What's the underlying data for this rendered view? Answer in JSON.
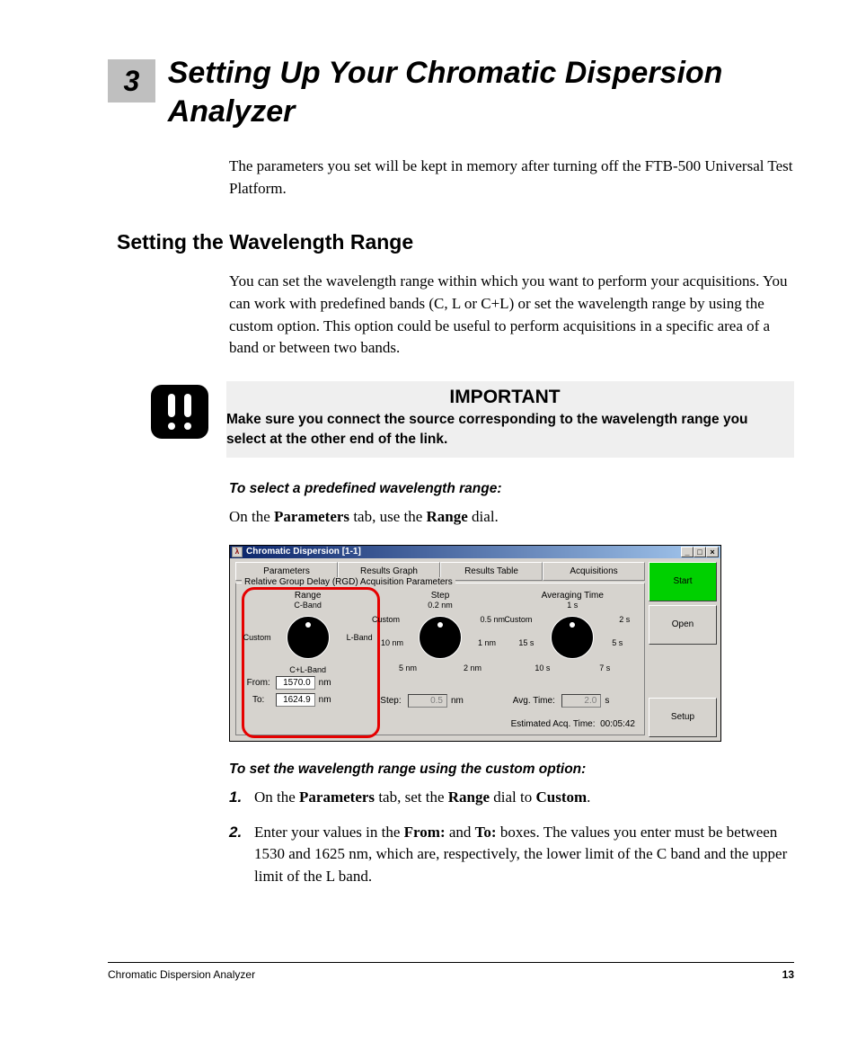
{
  "chapter": {
    "number": "3",
    "title": "Setting Up Your Chromatic Dispersion Analyzer"
  },
  "intro": "The parameters you set will be kept in memory after turning off the FTB-500 Universal Test Platform.",
  "section_heading": "Setting the Wavelength Range",
  "section_body": "You can set the wavelength range within which you want to perform your acquisitions. You can work with predefined bands (C, L or C+L) or set the wavelength range by using the custom option. This option could be useful to perform acquisitions in a specific area of a band or between two bands.",
  "important": {
    "heading": "IMPORTANT",
    "text": "Make sure you connect the source corresponding to the wavelength range you select at the other end of the link."
  },
  "procedure1": {
    "heading": "To select a predefined wavelength range:",
    "line_pre": "On the ",
    "line_b1": "Parameters",
    "line_mid": " tab, use the ",
    "line_b2": "Range",
    "line_post": " dial."
  },
  "procedure2": {
    "heading": "To set the wavelength range using the custom option:",
    "steps": [
      {
        "num": "1.",
        "pre": "On the ",
        "b1": "Parameters",
        "mid1": " tab, set the ",
        "b2": "Range",
        "mid2": " dial to ",
        "b3": "Custom",
        "post": "."
      },
      {
        "num": "2.",
        "pre": "Enter your values in the ",
        "b1": "From:",
        "mid1": " and ",
        "b2": "To:",
        "mid2": " boxes. The values you enter must be between 1530 and 1625 nm, which are, respectively, the lower limit of the C band and the upper limit of the L band.",
        "b3": "",
        "post": ""
      }
    ]
  },
  "screenshot": {
    "title": "Chromatic Dispersion [1-1]",
    "tabs": [
      "Parameters",
      "Results Graph",
      "Results Table",
      "Acquisitions"
    ],
    "groupbox_title": "Relative Group Delay (RGD) Acquisition Parameters",
    "range": {
      "title": "Range",
      "ticks": {
        "top": "C-Band",
        "left": "Custom",
        "right": "L-Band",
        "bottom": "C+L-Band"
      },
      "from_label": "From:",
      "from_value": "1570.0",
      "from_unit": "nm",
      "to_label": "To:",
      "to_value": "1624.9",
      "to_unit": "nm"
    },
    "step": {
      "title": "Step",
      "ticks": {
        "top": "0.2 nm",
        "tl": "Custom",
        "tr": "0.5 nm",
        "left": "10 nm",
        "right": "1 nm",
        "bl": "5 nm",
        "br": "2 nm"
      },
      "label": "Step:",
      "value": "0.5",
      "unit": "nm"
    },
    "avg": {
      "title": "Averaging Time",
      "ticks": {
        "top": "1 s",
        "tl": "Custom",
        "tr": "2 s",
        "left": "15 s",
        "right": "5 s",
        "bl": "10 s",
        "br": "7 s"
      },
      "label": "Avg. Time:",
      "value": "2.0",
      "unit": "s"
    },
    "est_label": "Estimated Acq. Time:",
    "est_value": "00:05:42",
    "buttons": {
      "start": "Start",
      "open": "Open",
      "setup": "Setup"
    }
  },
  "footer": {
    "product": "Chromatic Dispersion Analyzer",
    "page": "13"
  }
}
